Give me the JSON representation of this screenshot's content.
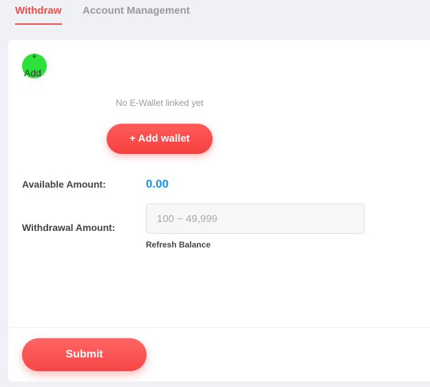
{
  "tabs": {
    "withdraw": "Withdraw",
    "account_management": "Account Management"
  },
  "wallet": {
    "add_plus": "+",
    "add_label": "Add",
    "empty_text": "No E-Wallet linked yet",
    "add_wallet_button": "+ Add wallet"
  },
  "form": {
    "available_label": "Available Amount:",
    "available_value": "0.00",
    "withdrawal_label": "Withdrawal Amount:",
    "withdrawal_placeholder": "100 ~ 49,999",
    "refresh_label": "Refresh Balance",
    "submit_label": "Submit"
  },
  "colors": {
    "accent_red": "#f04a4a",
    "amount_blue": "#1e90e8",
    "add_green": "#2ee03a"
  }
}
